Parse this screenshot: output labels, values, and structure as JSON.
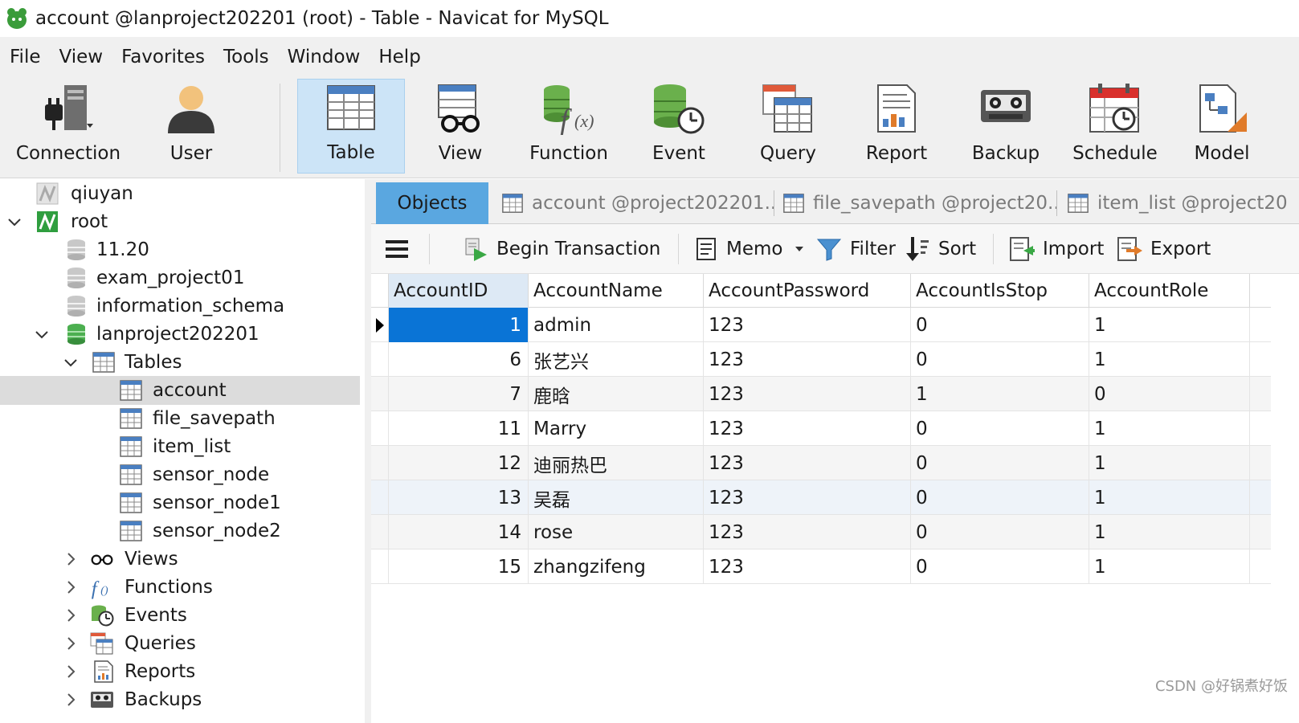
{
  "window": {
    "title": "account @lanproject202201 (root) - Table - Navicat for MySQL"
  },
  "menu": [
    "File",
    "View",
    "Favorites",
    "Tools",
    "Window",
    "Help"
  ],
  "toolbar": {
    "connection": "Connection",
    "user": "User",
    "table": "Table",
    "view": "View",
    "function": "Function",
    "event": "Event",
    "query": "Query",
    "report": "Report",
    "backup": "Backup",
    "schedule": "Schedule",
    "model": "Model"
  },
  "tree": {
    "conn1": "qiuyan",
    "conn2": "root",
    "db1": "11.20",
    "db2": "exam_project01",
    "db3": "information_schema",
    "db4": "lanproject202201",
    "tables_label": "Tables",
    "tables": [
      "account",
      "file_savepath",
      "item_list",
      "sensor_node",
      "sensor_node1",
      "sensor_node2"
    ],
    "views": "Views",
    "functions": "Functions",
    "events": "Events",
    "queries": "Queries",
    "reports": "Reports",
    "backups": "Backups"
  },
  "tabs": {
    "objects": "Objects",
    "tab1": "account @project202201...",
    "tab2": "file_savepath @project20...",
    "tab3": "item_list @project20"
  },
  "subtoolbar": {
    "begin_transaction": "Begin Transaction",
    "memo": "Memo",
    "filter": "Filter",
    "sort": "Sort",
    "import": "Import",
    "export": "Export"
  },
  "grid": {
    "columns": [
      "AccountID",
      "AccountName",
      "AccountPassword",
      "AccountIsStop",
      "AccountRole"
    ],
    "rows": [
      [
        "1",
        "admin",
        "123",
        "0",
        "1"
      ],
      [
        "6",
        "张艺兴",
        "123",
        "0",
        "1"
      ],
      [
        "7",
        "鹿晗",
        "123",
        "1",
        "0"
      ],
      [
        "11",
        "Marry",
        "123",
        "0",
        "1"
      ],
      [
        "12",
        "迪丽热巴",
        "123",
        "0",
        "1"
      ],
      [
        "13",
        "吴磊",
        "123",
        "0",
        "1"
      ],
      [
        "14",
        "rose",
        "123",
        "0",
        "1"
      ],
      [
        "15",
        "zhangzifeng",
        "123",
        "0",
        "1"
      ]
    ]
  },
  "watermark": "CSDN @好锅煮好饭",
  "colors": {
    "selection": "#0a74d6",
    "tab_active": "#5aa7e0",
    "toolbar_active": "#cce4f7"
  }
}
